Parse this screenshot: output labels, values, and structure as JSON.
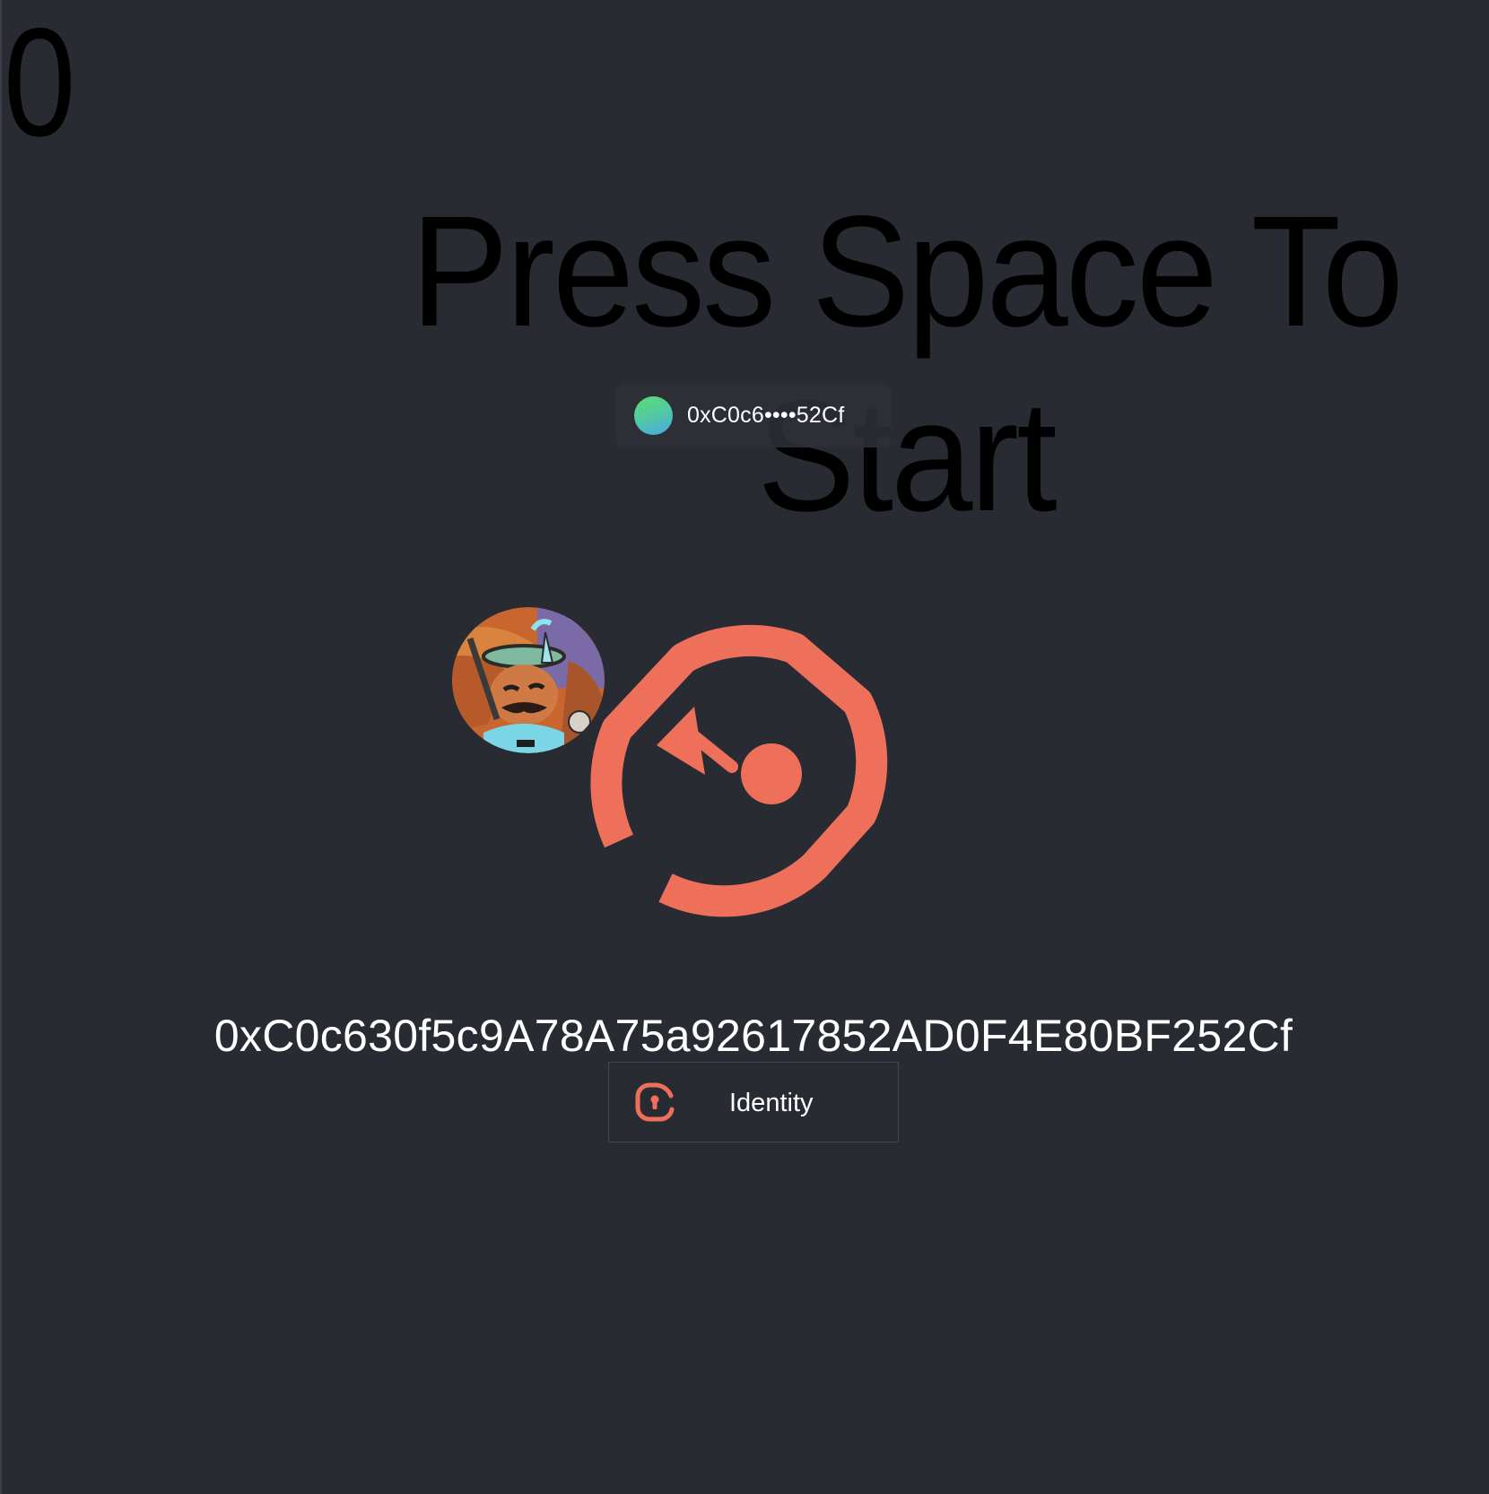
{
  "game": {
    "score": "0",
    "prompt": "Press Space To Start"
  },
  "wallet": {
    "short_address": "0xC0c6••••52Cf",
    "full_address": "0xC0c630f5c9A78A75a92617852AD0F4E80BF252Cf"
  },
  "identity_button": {
    "label": "Identity",
    "icon": "keyhole-lock-icon"
  },
  "icons": {
    "main_logo": "power-gauge-logo-icon",
    "avatar": "nft-avatar-image"
  },
  "colors": {
    "background": "#292b33",
    "accent": "#ee705a",
    "text": "#ffffff",
    "overlay_text": "#000000"
  }
}
